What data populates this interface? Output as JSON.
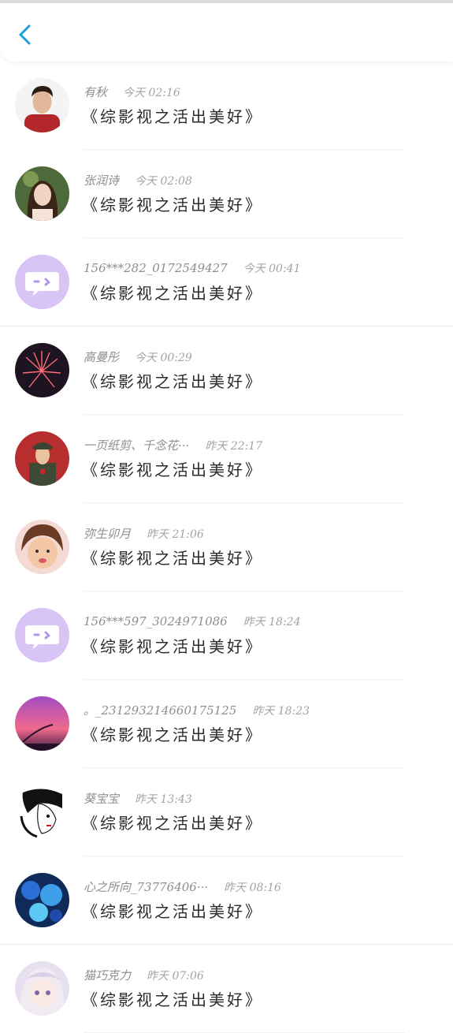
{
  "header": {
    "back_icon": "chevron-left-icon",
    "accent": "#1a9fe0"
  },
  "messages": [
    {
      "name": "有秋",
      "time": "今天 02:16",
      "text": "《综影视之活出美好》",
      "avatar": "man-red-shirt"
    },
    {
      "name": "张润诗",
      "time": "今天 02:08",
      "text": "《综影视之活出美好》",
      "avatar": "woman-portrait"
    },
    {
      "name": "156***282_0172549427",
      "time": "今天 00:41",
      "text": "《综影视之活出美好》",
      "avatar": "default-chat"
    },
    {
      "name": "高曼彤",
      "time": "今天 00:29",
      "text": "《综影视之活出美好》",
      "avatar": "fireworks"
    },
    {
      "name": "一页纸剪、千念花···",
      "time": "昨天 22:17",
      "text": "《综影视之活出美好》",
      "avatar": "soldier"
    },
    {
      "name": "弥生卯月",
      "time": "昨天 21:06",
      "text": "《综影视之活出美好》",
      "avatar": "child"
    },
    {
      "name": "156***597_3024971086",
      "time": "昨天 18:24",
      "text": "《综影视之活出美好》",
      "avatar": "default-chat"
    },
    {
      "name": "。_231293214660175125",
      "time": "昨天 18:23",
      "text": "《综影视之活出美好》",
      "avatar": "sunset"
    },
    {
      "name": "葵宝宝",
      "time": "昨天 13:43",
      "text": "《综影视之活出美好》",
      "avatar": "sketch-girl"
    },
    {
      "name": "心之所向_73776406···",
      "time": "昨天 08:16",
      "text": "《综影视之活出美好》",
      "avatar": "blue-art"
    },
    {
      "name": "猫巧克力",
      "time": "昨天 07:06",
      "text": "《综影视之活出美好》",
      "avatar": "anime-girl"
    }
  ]
}
